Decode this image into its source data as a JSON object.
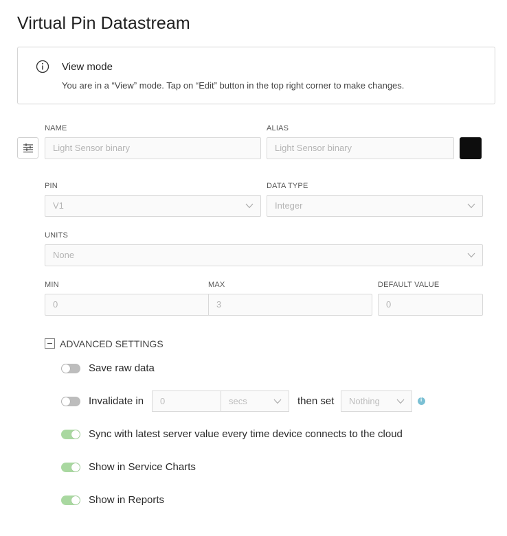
{
  "page_title": "Virtual Pin Datastream",
  "notice": {
    "icon": "info-icon",
    "title": "View mode",
    "text": "You are in a “View” mode. Tap on “Edit” button in the top right corner to make changes."
  },
  "form": {
    "name": {
      "label": "NAME",
      "placeholder": "Light Sensor  binary"
    },
    "alias": {
      "label": "ALIAS",
      "placeholder": "Light Sensor  binary"
    },
    "color": "#0d0d0d",
    "pin": {
      "label": "PIN",
      "value": "V1"
    },
    "data_type": {
      "label": "DATA TYPE",
      "value": "Integer"
    },
    "units": {
      "label": "UNITS",
      "value": "None"
    },
    "min": {
      "label": "MIN",
      "value": "0"
    },
    "max": {
      "label": "MAX",
      "value": "3"
    },
    "default_value": {
      "label": "DEFAULT VALUE",
      "value": "0"
    }
  },
  "advanced": {
    "label": "ADVANCED SETTINGS",
    "save_raw": {
      "label": "Save raw data",
      "on": false
    },
    "invalidate": {
      "label": "Invalidate in",
      "value": "0",
      "unit": "secs",
      "then_label": "then set",
      "then_value": "Nothing",
      "on": false
    },
    "sync": {
      "label": "Sync with latest server value every time device connects to the cloud",
      "on": true
    },
    "service_charts": {
      "label": "Show in Service Charts",
      "on": true
    },
    "reports": {
      "label": "Show in Reports",
      "on": true
    }
  },
  "colors": {
    "toggle_on": "#a9d8a0",
    "toggle_off": "#bdbdbd",
    "info_dot": "#7bc0d4"
  }
}
